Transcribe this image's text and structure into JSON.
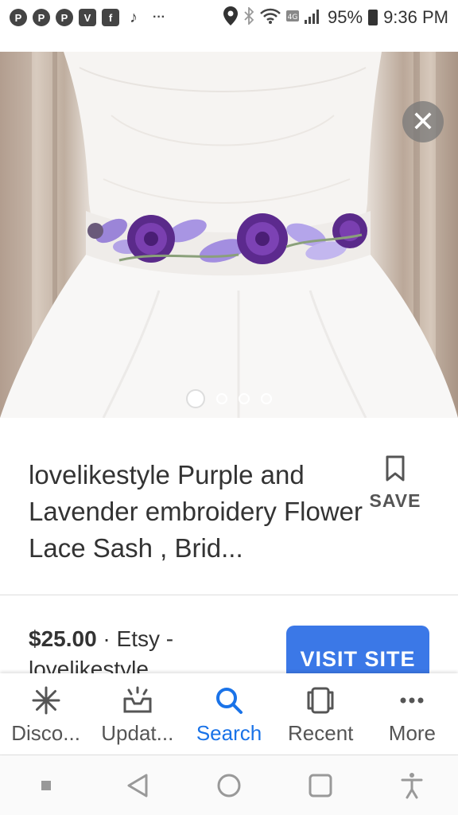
{
  "status_bar": {
    "left_icons": [
      "pinterest-icon",
      "pinterest-icon",
      "pinterest-icon",
      "v-icon",
      "facebook-icon",
      "tiktok-icon",
      "more-dots-icon"
    ],
    "battery": "95%",
    "time": "9:36 PM"
  },
  "carousel": {
    "count": 4,
    "active_index": 0
  },
  "product": {
    "title": "lovelikestyle Purple and Lavender embroidery Flower Lace Sash , Brid...",
    "save_label": "SAVE",
    "price": "$25.00",
    "source": " · Etsy - lovelikestyle",
    "visit_label": "VISIT SITE"
  },
  "bottom_nav": {
    "items": [
      {
        "label": "Disco...",
        "icon": "discover-asterisk-icon"
      },
      {
        "label": "Updat...",
        "icon": "updates-inbox-icon"
      },
      {
        "label": "Search",
        "icon": "search-icon"
      },
      {
        "label": "Recent",
        "icon": "recent-cards-icon"
      },
      {
        "label": "More",
        "icon": "more-dots-icon"
      }
    ],
    "active_label": "Search"
  },
  "colors": {
    "accent": "#1a73e8",
    "visit_button": "#3b78e7"
  }
}
